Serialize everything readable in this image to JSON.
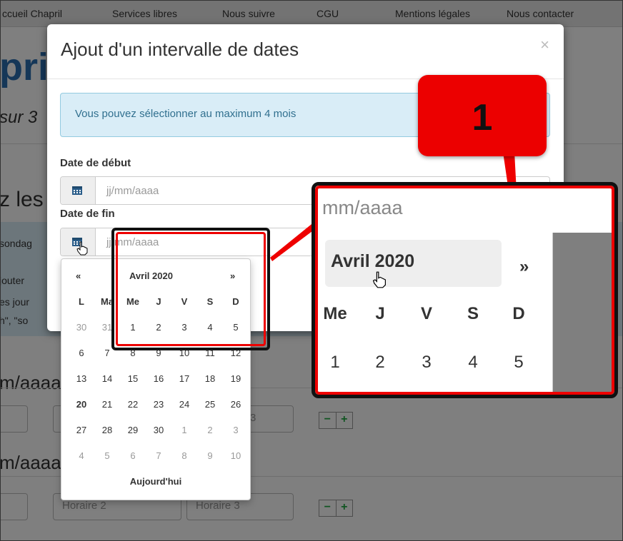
{
  "topnav": {
    "items": [
      "ccueil Chapril",
      "Services libres",
      "Nous suivre",
      "CGU",
      "Mentions légales",
      "Nous contacter"
    ]
  },
  "background": {
    "logo_fragment": "pri",
    "subtitle_fragment": "sur 3",
    "heading_fragment": "z les",
    "band_lines": [
      "sondag",
      "jouter",
      "es jour",
      "h\", \"so"
    ],
    "date_fragment_1": "m/aaaa",
    "date_fragment_2": "m/aaaa",
    "field_horaire_2": "Horaire 2",
    "field_horaire_3": "Horaire 3",
    "field_partial": "3",
    "minus": "−",
    "plus": "+"
  },
  "modal": {
    "title": "Ajout d'un intervalle de dates",
    "close": "×",
    "alert": "Vous pouvez sélectionner au maximum 4 mois",
    "start_label": "Date de début",
    "start_placeholder": "jj/mm/aaaa",
    "end_label": "Date de fin",
    "end_placeholder": "jj/mm/aaaa"
  },
  "datepicker": {
    "prev": "«",
    "month": "Avril 2020",
    "next": "»",
    "weekdays": [
      "L",
      "Ma",
      "Me",
      "J",
      "V",
      "S",
      "D"
    ],
    "weeks": [
      [
        "30",
        "31",
        "1",
        "2",
        "3",
        "4",
        "5"
      ],
      [
        "6",
        "7",
        "8",
        "9",
        "10",
        "11",
        "12"
      ],
      [
        "13",
        "14",
        "15",
        "16",
        "17",
        "18",
        "19"
      ],
      [
        "20",
        "21",
        "22",
        "23",
        "24",
        "25",
        "26"
      ],
      [
        "27",
        "28",
        "29",
        "30",
        "1",
        "2",
        "3"
      ],
      [
        "4",
        "5",
        "6",
        "7",
        "8",
        "9",
        "10"
      ]
    ],
    "today_button": "Aujourd'hui"
  },
  "callout": {
    "number": "1"
  },
  "zoom": {
    "input_text": "mm/aaaa",
    "month": "Avril 2020",
    "next": "»",
    "weekdays": [
      "Me",
      "J",
      "V",
      "S",
      "D"
    ],
    "days": [
      "1",
      "2",
      "3",
      "4",
      "5"
    ]
  },
  "colors": {
    "highlight_red": "#e00000",
    "alert_bg": "#d9edf7",
    "alert_text": "#31708f",
    "overlay": "rgba(0,0,0,0.5)"
  }
}
